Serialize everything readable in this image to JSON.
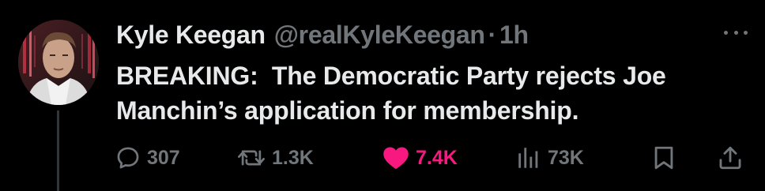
{
  "tweet": {
    "author_name": "Kyle Keegan",
    "handle": "@realKyleKeegan",
    "separator": "·",
    "time": "1h",
    "text": "BREAKING:  The Democratic Party rejects Joe Manchin’s application for membership.",
    "stats": {
      "replies": "307",
      "retweets": "1.3K",
      "likes": "7.4K",
      "views": "73K"
    }
  },
  "colors": {
    "background": "#000000",
    "text": "#e7e9ea",
    "muted": "#71767b",
    "like_accent": "#f91880"
  },
  "icons": {
    "avatar": "avatar-image",
    "more": "more-dots-icon",
    "reply": "reply-bubble-icon",
    "retweet": "retweet-icon",
    "like": "heart-icon",
    "views": "views-bar-chart-icon",
    "bookmark": "bookmark-icon",
    "share": "share-icon"
  }
}
